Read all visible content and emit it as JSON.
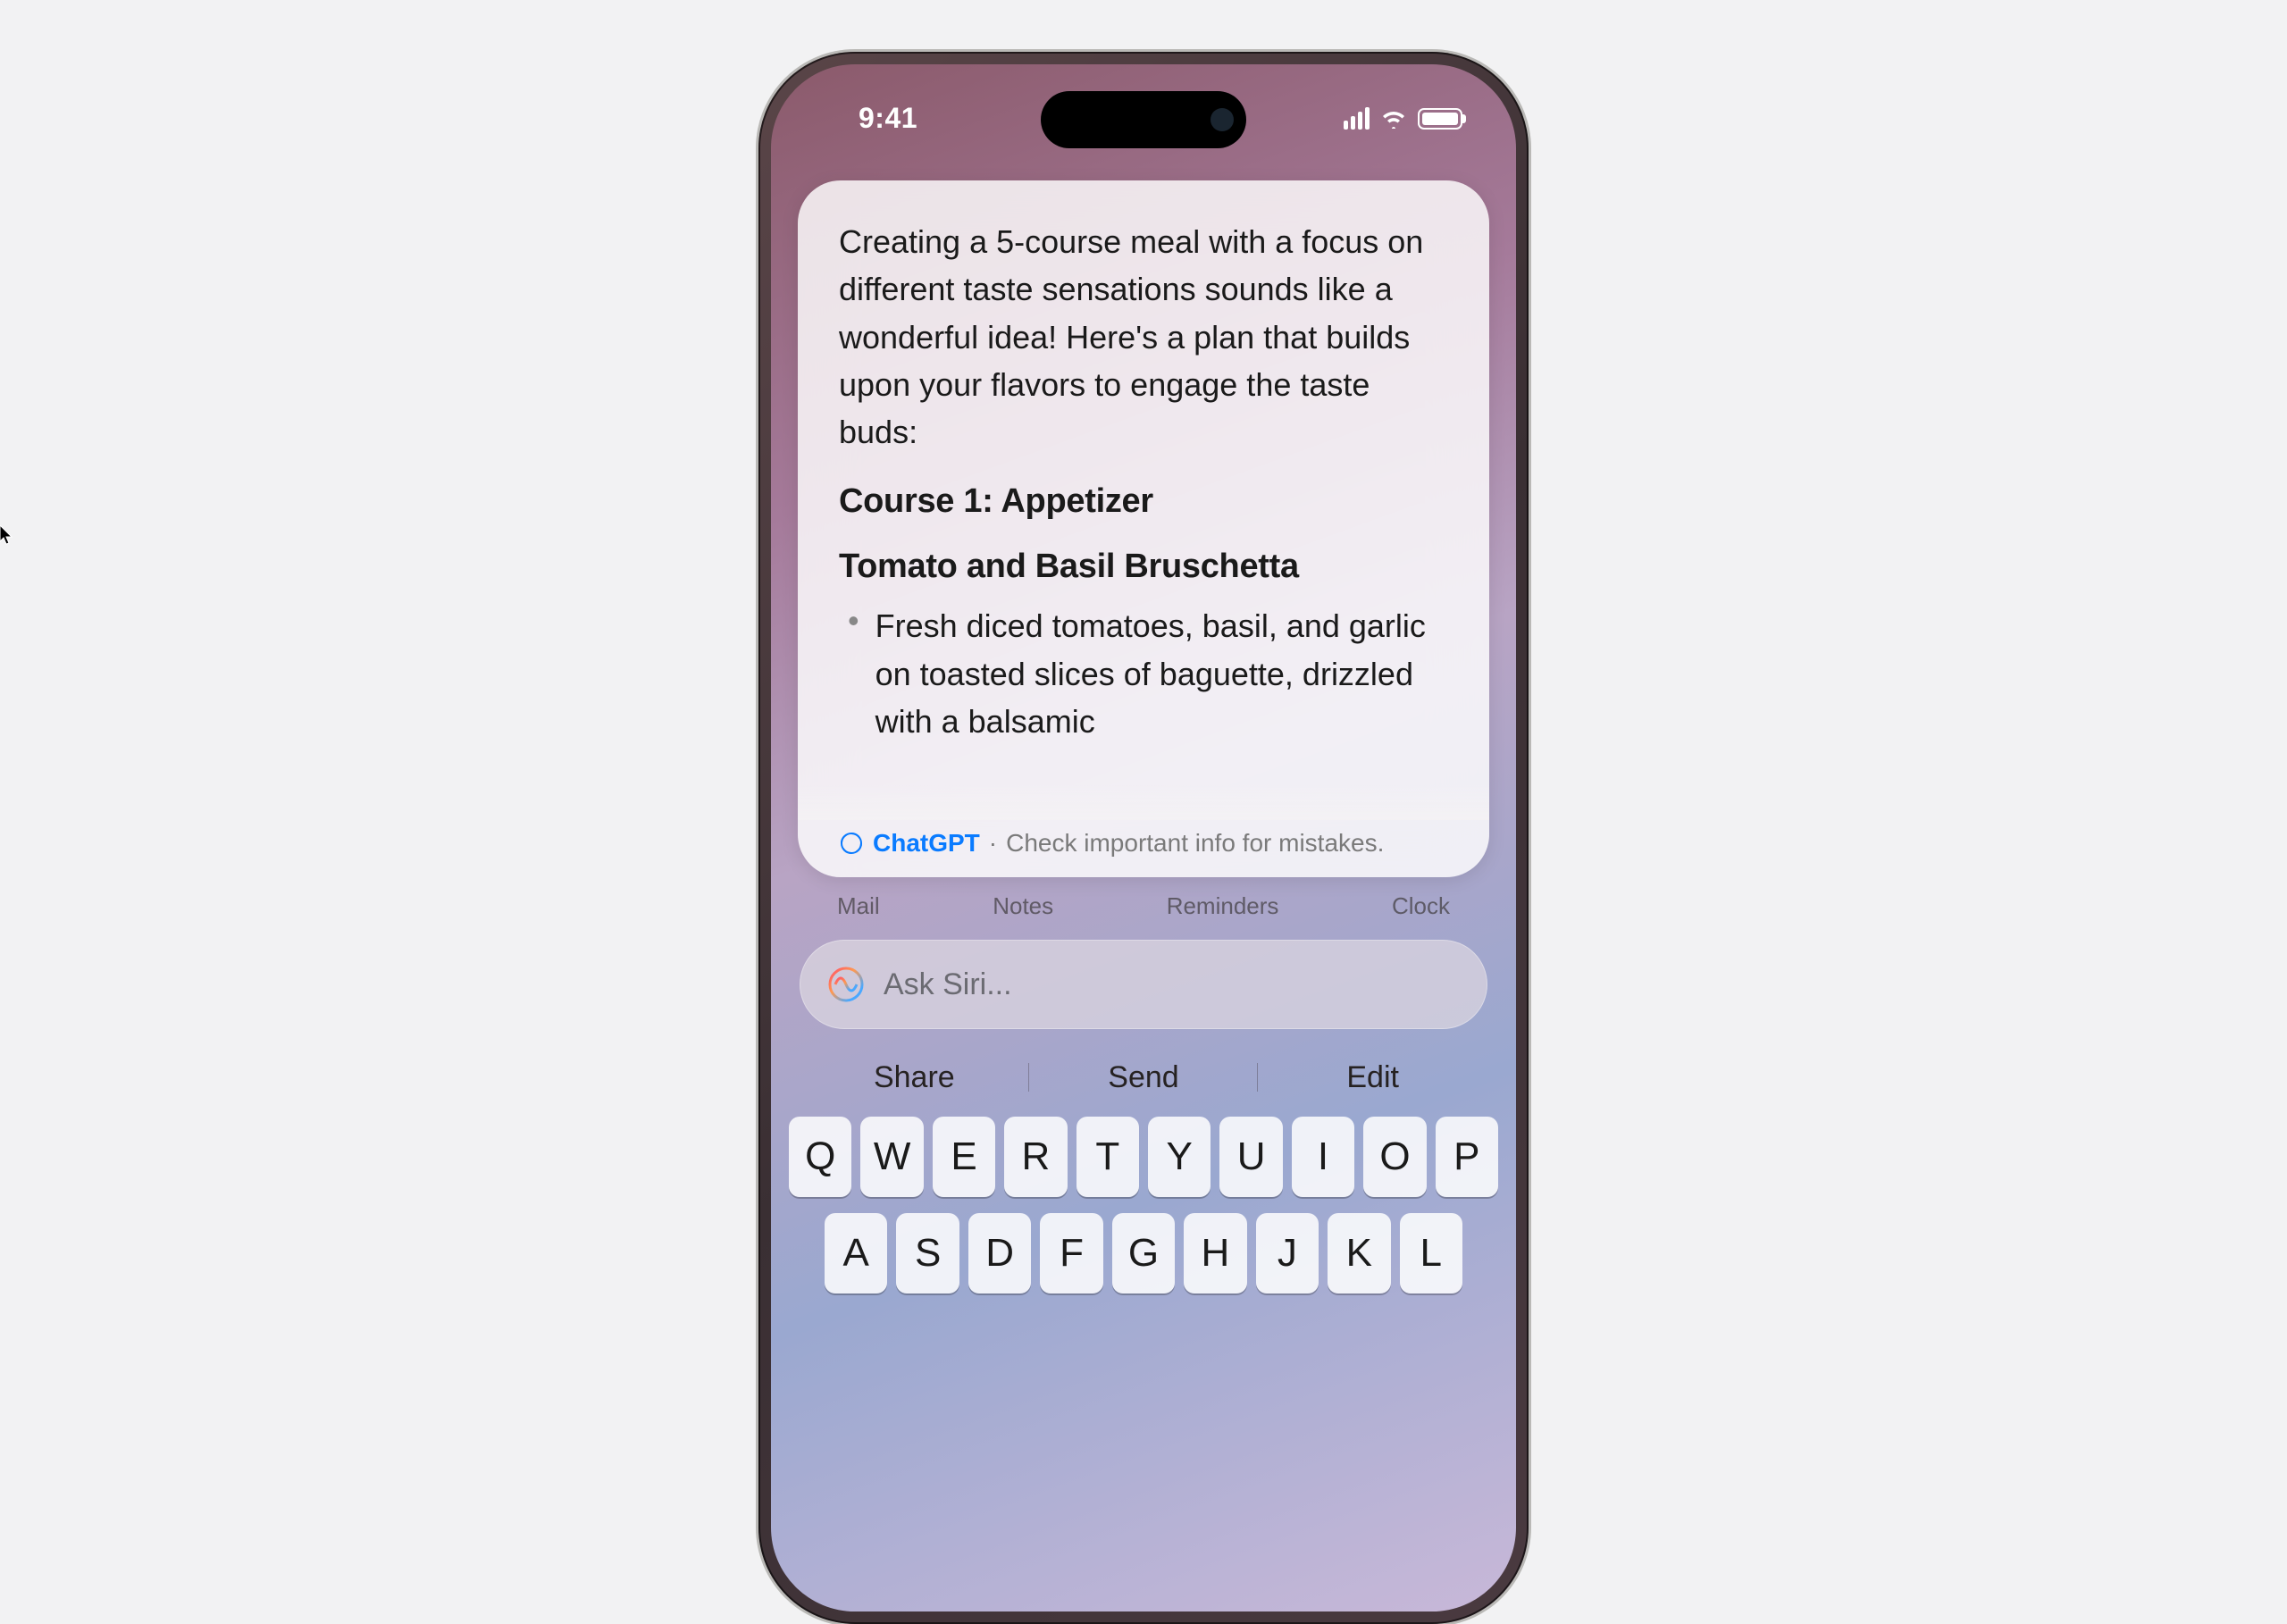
{
  "status": {
    "time": "9:41"
  },
  "response": {
    "intro": "Creating a 5-course meal with a focus on different taste sensations sounds like a wonderful idea! Here's a plan that builds upon your flavors to engage the taste buds:",
    "course_heading": "Course 1: Appetizer",
    "dish_heading": "Tomato and Basil Bruschetta",
    "bullet": "Fresh diced tomatoes, basil, and garlic on toasted slices of baguette, drizzled with a balsamic",
    "source_label": "ChatGPT",
    "separator": "·",
    "warning": "Check important info for mistakes."
  },
  "apps": {
    "a": "Mail",
    "b": "Notes",
    "c": "Reminders",
    "d": "Clock"
  },
  "siri": {
    "placeholder": "Ask Siri..."
  },
  "suggestions": {
    "a": "Share",
    "b": "Send",
    "c": "Edit"
  },
  "keys": {
    "r1": {
      "k0": "Q",
      "k1": "W",
      "k2": "E",
      "k3": "R",
      "k4": "T",
      "k5": "Y",
      "k6": "U",
      "k7": "I",
      "k8": "O",
      "k9": "P"
    },
    "r2": {
      "k0": "A",
      "k1": "S",
      "k2": "D",
      "k3": "F",
      "k4": "G",
      "k5": "H",
      "k6": "J",
      "k7": "K",
      "k8": "L"
    }
  }
}
